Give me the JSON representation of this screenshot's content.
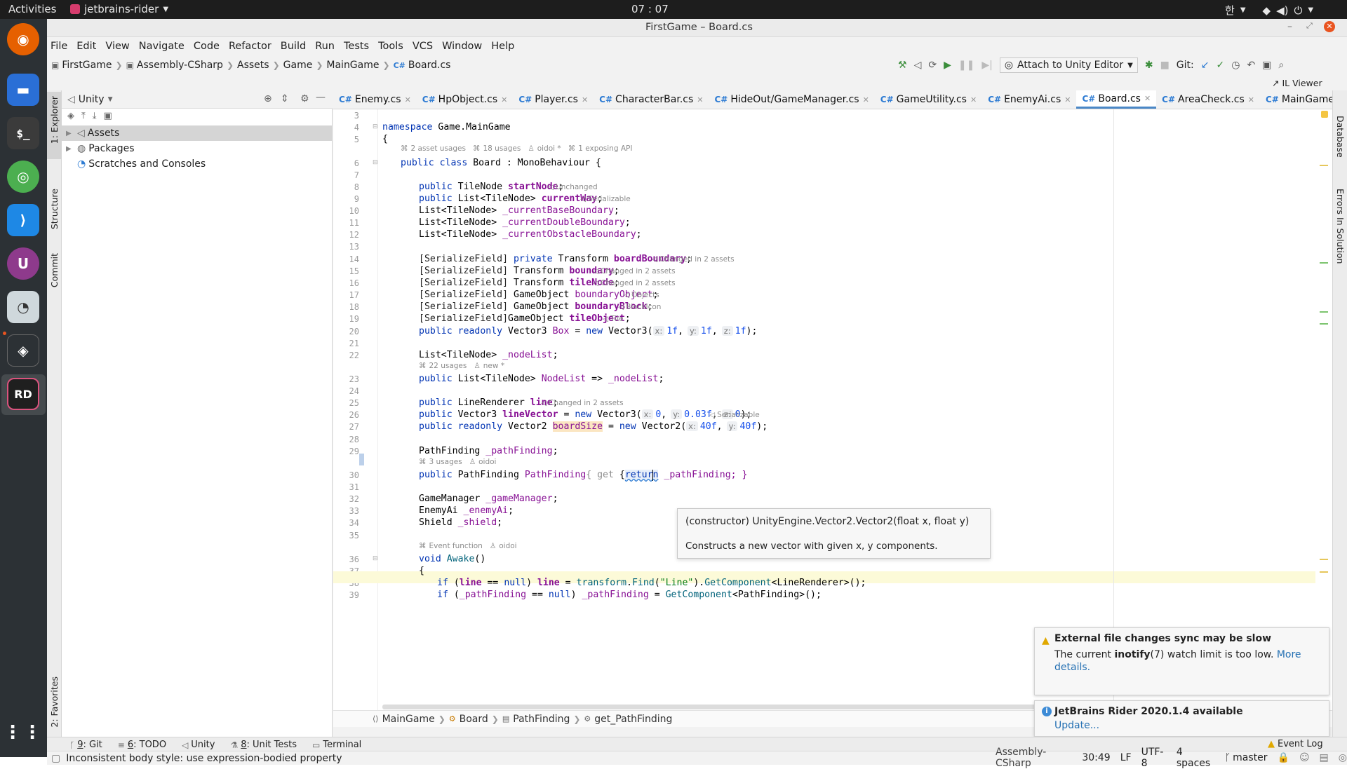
{
  "topbar": {
    "activities": "Activities",
    "app_name": "jetbrains-rider",
    "clock": "07 : 07",
    "input_method": "한"
  },
  "window": {
    "title": "FirstGame – Board.cs"
  },
  "menu": [
    "File",
    "Edit",
    "View",
    "Navigate",
    "Code",
    "Refactor",
    "Build",
    "Run",
    "Tests",
    "Tools",
    "VCS",
    "Window",
    "Help"
  ],
  "breadcrumb": [
    "FirstGame",
    "Assembly-CSharp",
    "Assets",
    "Game",
    "MainGame",
    "Board.cs"
  ],
  "toolbar": {
    "attach_label": "Attach to Unity Editor",
    "git_label": "Git:",
    "il_viewer": "IL Viewer"
  },
  "left_tool_windows": {
    "explorer": "1: Explorer",
    "structure": "Structure",
    "commit": "Commit",
    "favorites": "2: Favorites"
  },
  "right_tool_windows": {
    "database": "Database",
    "errors": "Errors In Solution"
  },
  "explorer": {
    "dropdown": "Unity",
    "items": [
      "Assets",
      "Packages",
      "Scratches and Consoles"
    ]
  },
  "tabs": [
    "Enemy.cs",
    "HpObject.cs",
    "Player.cs",
    "CharacterBar.cs",
    "HideOut/GameManager.cs",
    "GameUtility.cs",
    "EnemyAi.cs",
    "Board.cs",
    "AreaCheck.cs",
    "MainGame/G"
  ],
  "tab_prefix": "C#",
  "active_tab": "Board.cs",
  "line_numbers": [
    "3",
    "4",
    "5",
    "6",
    "7",
    "8",
    "9",
    "10",
    "11",
    "12",
    "13",
    "14",
    "15",
    "16",
    "17",
    "18",
    "19",
    "20",
    "21",
    "22",
    "23",
    "24",
    "25",
    "26",
    "27",
    "28",
    "29",
    "30",
    "31",
    "32",
    "33",
    "34",
    "35",
    "36",
    "37",
    "38",
    "39"
  ],
  "code": {
    "l4_kw": "namespace",
    "l4_rest": " Game.MainGame",
    "l5": "{",
    "lens_class": [
      "2 asset usages",
      "18 usages",
      "oidoi *",
      "1 exposing API"
    ],
    "l6_kw": "public class",
    "l6_name": " Board",
    "l6_rest": " : MonoBehaviour {",
    "l8_kw": "public",
    "l8_type": " TileNode ",
    "l8_field": "startNode",
    "l8_end": ";",
    "l8_hint": "Unchanged",
    "l9_kw": "public",
    "l9_type": " List<TileNode> ",
    "l9_field": "currentWay",
    "l9_end": ";",
    "l9_hint": "Serializable",
    "l10_type": "List<TileNode> ",
    "l10_field": "_currentBaseBoundary",
    "l10_end": ";",
    "l11_type": "List<TileNode> ",
    "l11_field": "_currentDoubleBoundary",
    "l11_end": ";",
    "l12_type": "List<TileNode> ",
    "l12_field": "_currentObstacleBoundary",
    "l12_end": ";",
    "l14_attr": "[SerializeField] ",
    "l14_kw": "private",
    "l14_type": " Transform ",
    "l14_field": "boardBoundary",
    "l14_end": ";",
    "l14_hint": "Changed in 2 assets",
    "l15_attr": "[SerializeField]",
    "l15_type": " Transform ",
    "l15_field": "boundary",
    "l15_end": ";",
    "l15_hint": "Changed in 2 assets",
    "l16_attr": "[SerializeField]",
    "l16_type": " Transform ",
    "l16_field": "tileNode",
    "l16_end": ";",
    "l16_hint": "Changed in 2 assets",
    "l17_attr": "[SerializeField]",
    "l17_type": " GameObject ",
    "l17_field": "boundaryObject",
    "l17_end": ";",
    "l17_hint": "Objects",
    "l18_attr": "[SerializeField]",
    "l18_type": " GameObject ",
    "l18_field": "boundaryBlock",
    "l18_end": ";",
    "l18_hint": "BlockIcon",
    "l19_attr": "[SerializeField]",
    "l19_type": "GameObject ",
    "l19_field": "tileObject",
    "l19_end": ";",
    "l19_hint": "Tile",
    "l20_kw": "public readonly",
    "l20_type": " Vector3 ",
    "l20_field": "Box",
    "l20_mid": " = ",
    "l20_new": "new",
    "l20_ctor": " Vector3(",
    "l20_px": "x:",
    "l20_vx": "1f",
    "l20_py": "y:",
    "l20_vy": "1f",
    "l20_pz": "z:",
    "l20_vz": "1f",
    "l20_end": ");",
    "l22_type": "List<TileNode> ",
    "l22_field": "_nodeList",
    "l22_end": ";",
    "lens_nodelist": [
      "22 usages",
      "new *"
    ],
    "l23_kw": "public",
    "l23_type": " List<TileNode> ",
    "l23_prop": "NodeList",
    "l23_arrow": " => ",
    "l23_field": "_nodeList",
    "l23_end": ";",
    "l25_kw": "public",
    "l25_type": " LineRenderer ",
    "l25_field": "line",
    "l25_end": ";",
    "l25_hint": "Changed in 2 assets",
    "l26_kw": "public",
    "l26_type": " Vector3 ",
    "l26_field": "lineVector",
    "l26_mid": " = ",
    "l26_new": "new",
    "l26_ctor": " Vector3(",
    "l26_px": "x:",
    "l26_vx": "0",
    "l26_py": "y:",
    "l26_vy": "0.03f",
    "l26_pz": "z:",
    "l26_vz": "0",
    "l26_end": ");",
    "l26_hint": "Serializable",
    "l27_kw": "public readonly",
    "l27_type": " Vector2 ",
    "l27_field": "boardSize",
    "l27_mid": " = ",
    "l27_new": "new",
    "l27_ctor": " Vector2(",
    "l27_px": "x:",
    "l27_vx": "40f",
    "l27_py": "y:",
    "l27_vy": "40f",
    "l27_end": ");",
    "l29_type": "PathFinding ",
    "l29_field": "_pathFinding",
    "l29_end": ";",
    "lens_pathfinding": [
      "3 usages",
      "oidoi"
    ],
    "l30_kw": "public",
    "l30_type": " PathFinding ",
    "l30_prop": "PathFinding",
    "l30_a": "{ ",
    "l30_get": "get",
    "l30_b": " {",
    "l30_ret": "return",
    "l30_rest": " _pathFinding; }",
    "l32_type": "GameManager ",
    "l32_field": "_gameManager",
    "l32_end": ";",
    "l33_type": "EnemyAi ",
    "l33_field": "_enemyAi",
    "l33_end": ";",
    "l34_type": "Shield ",
    "l34_field": "_shield",
    "l34_end": ";",
    "lens_awake": [
      "Event function",
      "oidoi"
    ],
    "l36_kw": "void",
    "l36_meth": " Awake",
    "l36_end": "()",
    "l37": "{",
    "l38_kw": "if",
    "l38_a": " (",
    "l38_field": "line",
    "l38_b": " == ",
    "l38_null": "null",
    "l38_c": ") ",
    "l38_field2": "line",
    "l38_d": " = ",
    "l38_tr": "transform",
    "l38_e": ".",
    "l38_find": "Find",
    "l38_f": "(",
    "l38_str": "\"Line\"",
    "l38_g": ").",
    "l38_getc": "GetComponent",
    "l38_h": "<LineRenderer>();",
    "l39_kw": "if",
    "l39_a": " (",
    "l39_field": "_pathFinding",
    "l39_b": " == ",
    "l39_null": "null",
    "l39_c": ") ",
    "l39_field2": "_pathFinding",
    "l39_d": " = ",
    "l39_getc": "GetComponent",
    "l39_e": "<PathFinding>();"
  },
  "tooltip": {
    "signature": "(constructor) UnityEngine.Vector2.Vector2(float x, float y)",
    "description": "Constructs a new vector with given x, y components."
  },
  "editor_breadcrumb": [
    "MainGame",
    "Board",
    "PathFinding",
    "get_PathFinding"
  ],
  "notifications": [
    {
      "title": "External file changes sync may be slow",
      "body_a": "The current ",
      "body_bold": "inotify",
      "body_b": "(7) watch limit is too low. ",
      "link": "More details."
    },
    {
      "title": "JetBrains Rider 2020.1.4 available",
      "link": "Update..."
    }
  ],
  "bottom_tabs": [
    {
      "num": "9",
      "label": ": Git"
    },
    {
      "num": "6",
      "label": ": TODO"
    },
    {
      "num": "",
      "label": "Unity"
    },
    {
      "num": "8",
      "label": ": Unit Tests"
    },
    {
      "num": "",
      "label": "Terminal"
    }
  ],
  "event_log": "Event Log",
  "status": {
    "message": "Inconsistent body style: use expression-bodied property",
    "project": "Assembly-CSharp",
    "position": "30:49",
    "line_sep": "LF",
    "encoding": "UTF-8",
    "indent": "4 spaces",
    "branch": "master"
  },
  "colors": {
    "accent": "#4a88c7",
    "keyword": "#0033b3",
    "field": "#871094",
    "number": "#1750eb",
    "string": "#067d17",
    "dock_bg": "#2c3135"
  }
}
